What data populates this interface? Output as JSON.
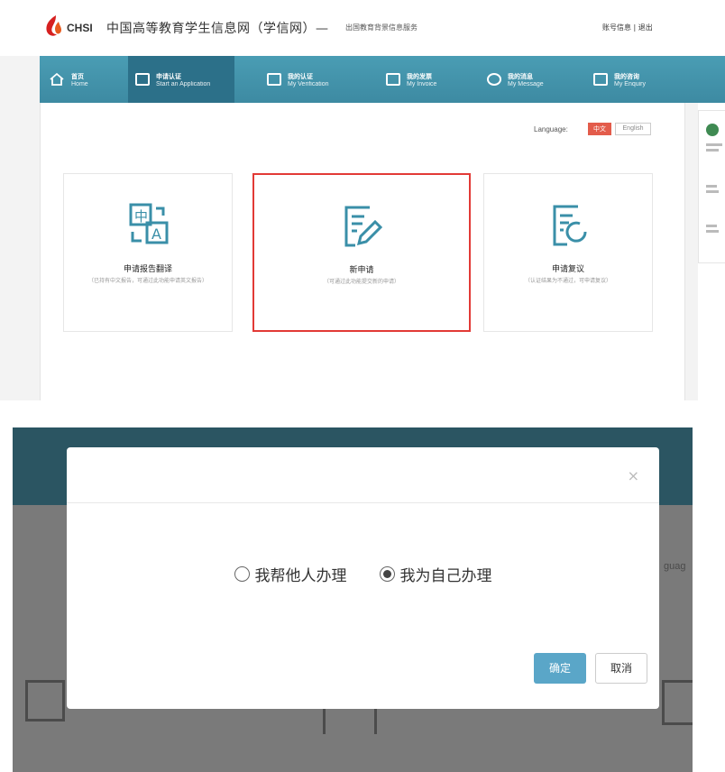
{
  "header": {
    "logo_text": "CHSI",
    "site_title": "中国高等教育学生信息网（学信网）— ",
    "site_subtitle": "出国教育背景信息服务",
    "account_text": "账号信息 | 退出"
  },
  "nav": {
    "items": [
      {
        "label_zh": "首页",
        "label_en": "Home",
        "icon": "home-icon"
      },
      {
        "label_zh": "申请认证",
        "label_en": "Start an Application",
        "icon": "check-square-icon",
        "active": true
      },
      {
        "label_zh": "我的认证",
        "label_en": "My Verification",
        "icon": "document-icon"
      },
      {
        "label_zh": "我的发票",
        "label_en": "My Invoice",
        "icon": "invoice-icon"
      },
      {
        "label_zh": "我的消息",
        "label_en": "My Message",
        "icon": "message-icon"
      },
      {
        "label_zh": "我的咨询",
        "label_en": "My Enquiry",
        "icon": "enquiry-icon"
      }
    ]
  },
  "language": {
    "label": "Language:",
    "zh": "中文",
    "en": "English"
  },
  "cards": [
    {
      "title": "申请报告翻译",
      "desc": "（已持有中文报告，可通过此功能申请英文报告）",
      "icon": "translate-icon"
    },
    {
      "title": "新申请",
      "desc": "（可通过此功能提交新的申请）",
      "icon": "edit-document-icon",
      "selected": true
    },
    {
      "title": "申请复议",
      "desc": "（认证结果为不通过，可申请复议）",
      "icon": "review-document-icon"
    }
  ],
  "modal": {
    "option_other": "我帮他人办理",
    "option_self": "我为自己办理",
    "selected": "self",
    "ok": "确定",
    "cancel": "取消",
    "close": "×"
  },
  "background": {
    "partial_lang": "guag"
  },
  "colors": {
    "nav_bg": "#4a9db4",
    "nav_active": "#2c7089",
    "lang_zh_bg": "#e35c4b",
    "selected_border": "#e23a36",
    "ok_button": "#5aa6c8",
    "card_icon": "#3a8fa8"
  }
}
